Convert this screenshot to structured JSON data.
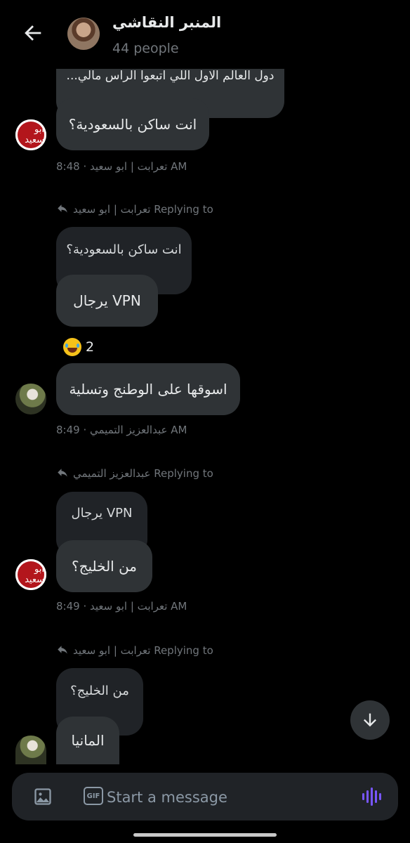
{
  "header": {
    "title": "المنبر النقاشي",
    "member_count": "44 people"
  },
  "messages": [
    {
      "text": "دول العالم الاول اللي اتبعوا الراس مالي..."
    },
    {
      "text": "انت ساكن بالسعودية؟",
      "meta": "تعرابت | ابو سعيد · 8:48 AM"
    },
    {
      "reply": "تعرابت | ابو سعيد Replying to",
      "quote": "انت ساكن بالسعودية؟",
      "text": "VPN يرجال",
      "reaction_count": "2"
    },
    {
      "text": "اسوقها على الوطنج وتسلية",
      "meta": "عبدالعزيز التميمي · 8:49 AM"
    },
    {
      "reply": "عبدالعزيز التميمي Replying to",
      "quote": "VPN يرجال",
      "text": "من الخليج؟",
      "meta": "تعرابت | ابو سعيد · 8:49 AM"
    },
    {
      "reply": "تعرابت | ابو سعيد Replying to",
      "quote": "من الخليج؟",
      "text": "المانيا"
    }
  ],
  "avatar_label": "ابو سعيد",
  "composer": {
    "placeholder": "Start a message",
    "gif_label": "GIF"
  },
  "colors": {
    "background": "#000000",
    "bubble": "#2f3336",
    "quote_bubble": "#202327",
    "muted_text": "#71767b",
    "voice_accent": "#7856ff"
  }
}
